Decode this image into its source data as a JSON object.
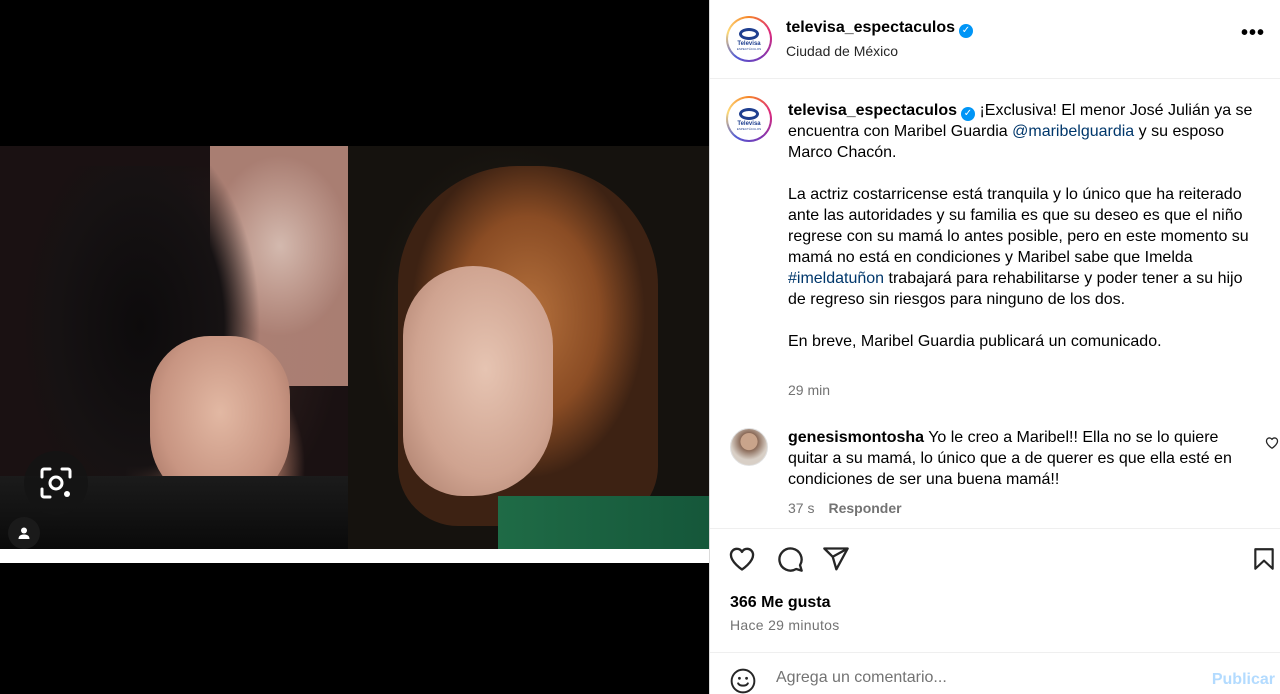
{
  "header": {
    "username": "televisa_espectaculos",
    "location": "Ciudad de México",
    "logo_text": "Televisa",
    "logo_sub": "ESPECTÁCULOS"
  },
  "caption": {
    "username": "televisa_espectaculos",
    "p1_a": "¡Exclusiva! El menor José Julián ya se encuentra con Maribel Guardia ",
    "p1_mention": "@maribelguardia",
    "p1_b": " y su esposo Marco Chacón.",
    "p2_a": "La actriz costarricense está tranquila y lo único que ha reiterado ante las autoridades y su familia es que su deseo es que el niño regrese con su mamá lo antes posible, pero en este momento su mamá no está en condiciones y Maribel sabe que Imelda ",
    "p2_hashtag": "#imeldatuñon",
    "p2_b": " trabajará para rehabilitarse y poder tener a su hijo de regreso sin riesgos para ninguno de los dos.",
    "p3": "En breve, Maribel Guardia publicará un comunicado.",
    "time": "29 min"
  },
  "comment": {
    "username": "genesismontosha",
    "text": " Yo le creo a Maribel!! Ella no se lo quiere quitar a su mamá, lo único que a de querer es que ella esté en condiciones de ser una buena mamá!!",
    "time": "37 s",
    "reply_label": "Responder"
  },
  "stats": {
    "likes": "366 Me gusta",
    "ago": "Hace 29 minutos"
  },
  "composer": {
    "placeholder": "Agrega un comentario...",
    "publish_label": "Publicar"
  },
  "colors": {
    "verified": "#0095f6",
    "link": "#00376b",
    "publish_disabled": "#b3dbff",
    "muted": "#737373"
  },
  "icons": [
    "visual-search-icon",
    "user-tag-icon",
    "more-options-icon",
    "heart-icon",
    "comment-icon",
    "share-icon",
    "bookmark-icon",
    "emoji-icon",
    "verified-badge-icon"
  ]
}
